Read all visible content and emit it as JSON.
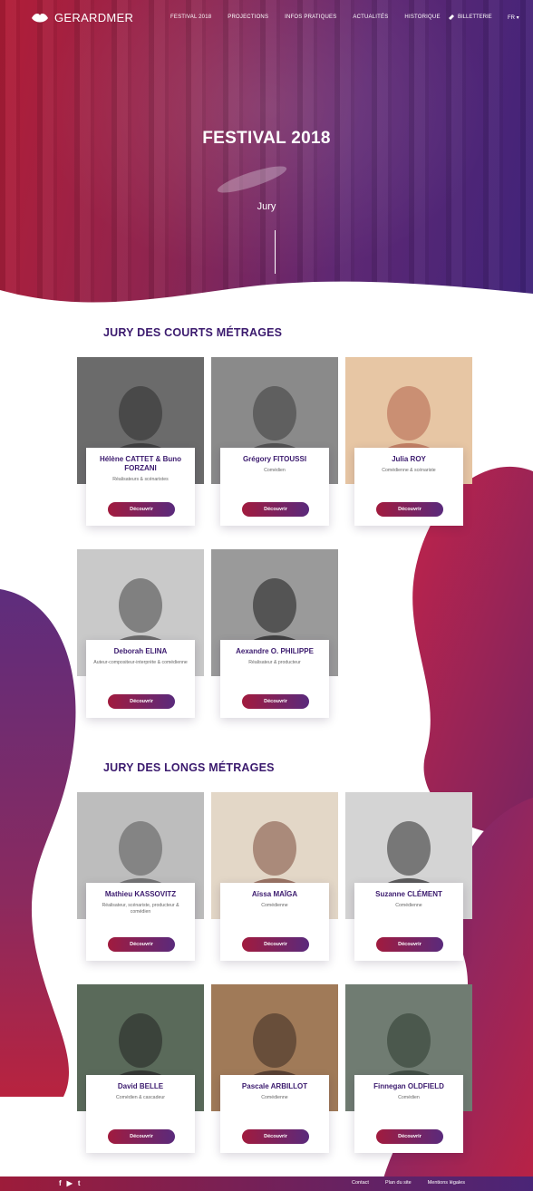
{
  "header": {
    "logo_text": "GERARDMER",
    "menu": [
      "FESTIVAL 2018",
      "PROJECTIONS",
      "INFOS PRATIQUES",
      "ACTUALITÉS",
      "HISTORIQUE"
    ],
    "ticket_label": "BILLETTERIE",
    "lang_label": "FR ▾"
  },
  "hero": {
    "title": "FESTIVAL 2018",
    "subtitle": "Jury"
  },
  "sections": {
    "courts_title": "JURY DES COURTS MÉTRAGES",
    "longs_title": "JURY DES LONGS MÉTRAGES"
  },
  "button_label": "Découvrir",
  "courts": [
    {
      "name": "Hélène CATTET & Buno FORZANI",
      "role": "Réalisateurs & scénaristes"
    },
    {
      "name": "Grégory FITOUSSI",
      "role": "Comédien"
    },
    {
      "name": "Julia ROY",
      "role": "Comédienne & scénariste"
    },
    {
      "name": "Deborah ELINA",
      "role": "Auteur-compositeur-interprète & comédienne"
    },
    {
      "name": "Aexandre O. PHILIPPE",
      "role": "Réalisateur & producteur"
    }
  ],
  "longs": [
    {
      "name": "Mathieu KASSOVITZ",
      "role": "Réalisateur, scénariste, producteur & comédien"
    },
    {
      "name": "Aïssa MAÏGA",
      "role": "Comédienne"
    },
    {
      "name": "Suzanne CLÉMENT",
      "role": "Comédienne"
    },
    {
      "name": "David BELLE",
      "role": "Comédien & cascadeur"
    },
    {
      "name": "Pascale ARBILLOT",
      "role": "Comédienne"
    },
    {
      "name": "Finnegan OLDFIELD",
      "role": "Comédien"
    }
  ],
  "footer": {
    "social": [
      "f",
      "▶",
      "t"
    ],
    "links": [
      "Contact",
      "Plan du site",
      "Mentions légales"
    ]
  },
  "colors": {
    "brand_red": "#a11b3e",
    "brand_purple": "#4a2577",
    "title_purple": "#3b1a6e"
  }
}
